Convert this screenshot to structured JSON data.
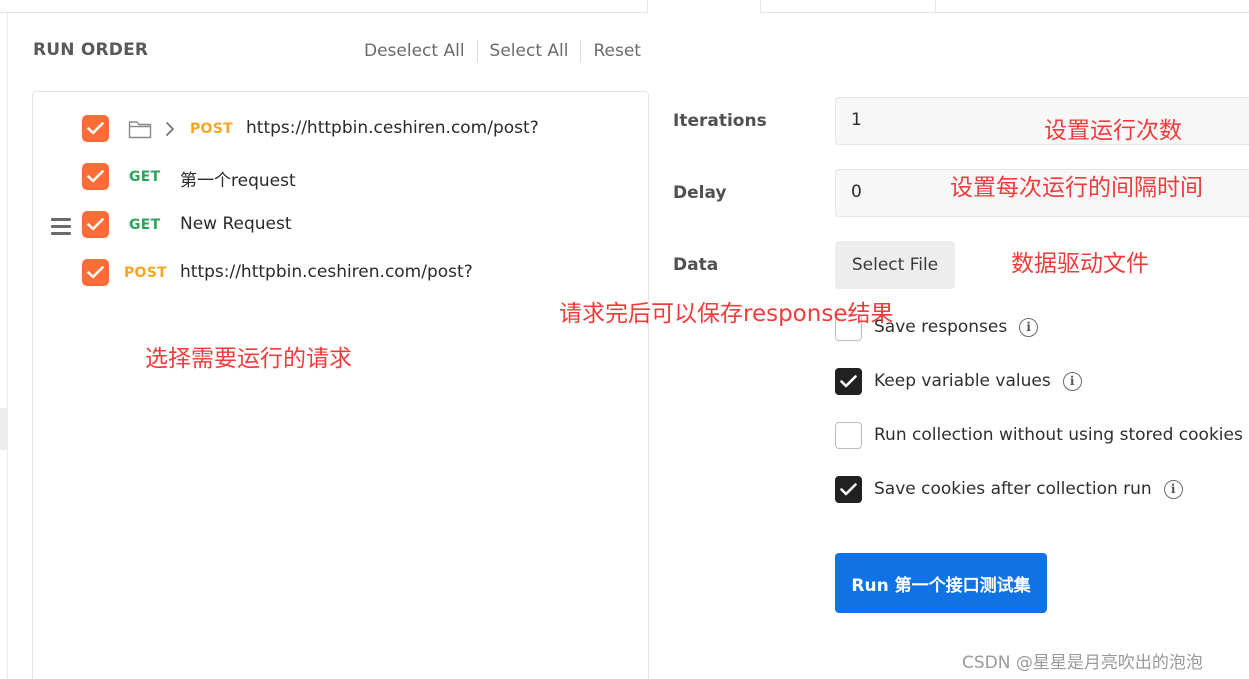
{
  "run_order": {
    "title": "RUN ORDER",
    "actions": {
      "deselect_all": "Deselect All",
      "select_all": "Select All",
      "reset": "Reset"
    }
  },
  "requests": [
    {
      "method": "POST",
      "name": "https://httpbin.ceshiren.com/post?",
      "checked": true,
      "in_folder": true
    },
    {
      "method": "GET",
      "name": "第一个request",
      "checked": true
    },
    {
      "method": "GET",
      "name": "New Request",
      "checked": true,
      "drag_handle": true
    },
    {
      "method": "POST",
      "name": "https://httpbin.ceshiren.com/post?",
      "checked": true
    }
  ],
  "settings": {
    "iterations_label": "Iterations",
    "iterations_value": "1",
    "delay_label": "Delay",
    "delay_value": "0",
    "data_label": "Data",
    "select_file": "Select File"
  },
  "options": [
    {
      "label": "Save responses",
      "checked": false,
      "info": true
    },
    {
      "label": "Keep variable values",
      "checked": true,
      "info": true
    },
    {
      "label": "Run collection without using stored cookies",
      "checked": false,
      "info": false
    },
    {
      "label": "Save cookies after collection run",
      "checked": true,
      "info": true
    }
  ],
  "run_button": "Run 第一个接口测试集",
  "annotations": {
    "iterations": "设置运行次数",
    "delay": "设置每次运行的间隔时间",
    "data": "数据驱动文件",
    "save_responses": "请求完后可以保存response结果",
    "select_requests": "选择需要运行的请求"
  },
  "watermark": "CSDN @星星是月亮吹出的泡泡",
  "colors": {
    "checkbox_accent": "#ff6c37",
    "post": "#f5a623",
    "get": "#26a65b",
    "run_button": "#0f73e6",
    "annotation": "#f23b3b"
  }
}
